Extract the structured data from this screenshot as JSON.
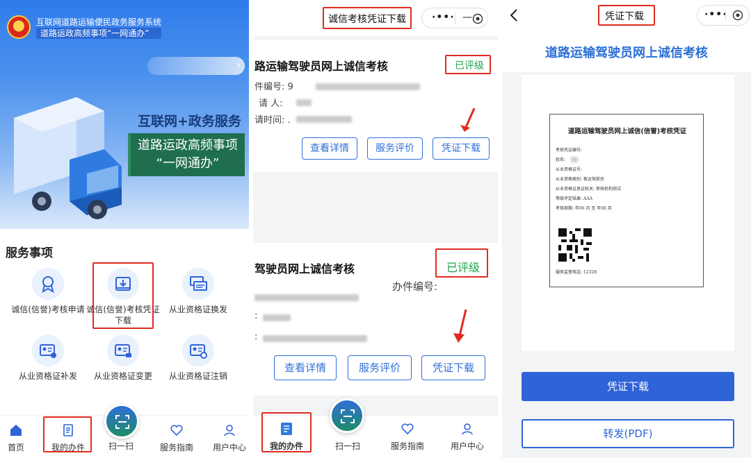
{
  "panel1": {
    "system_name": "互联网道路运输便民政务服务系统",
    "system_subtitle": "道路运政高频事项“一网通办”",
    "slogan_line": "互联网+政务服务",
    "banner_line1": "道路运政高频事项",
    "banner_line2": "“一网通办”",
    "services_title": "服务事项",
    "services": [
      {
        "label": "诚信(信誉)考核申请",
        "icon": "certificate-medal-icon"
      },
      {
        "label": "诚信(信誉)考核凭证下载",
        "icon": "download-tray-icon"
      },
      {
        "label": "从业资格证换发",
        "icon": "card-swap-icon"
      },
      {
        "label": "从业资格证补发",
        "icon": "id-card-add-icon"
      },
      {
        "label": "从业资格证变更",
        "icon": "id-card-edit-icon"
      },
      {
        "label": "从业资格证注销",
        "icon": "id-card-cancel-icon"
      }
    ],
    "tabs": [
      {
        "label": "首页",
        "icon": "home-icon"
      },
      {
        "label": "我的办件",
        "icon": "document-icon"
      },
      {
        "label": "扫一扫",
        "icon": "scan-icon"
      },
      {
        "label": "服务指南",
        "icon": "heart-icon"
      },
      {
        "label": "用户中心",
        "icon": "user-icon"
      }
    ]
  },
  "panel2": {
    "nav_title": "诚信考核凭证下载",
    "card1": {
      "title": "路运输驾驶员网上诚信考核",
      "status": "已评级",
      "field1_label": "件编号: 9",
      "field2_label": "请 人:",
      "field3_label": "请时间: .",
      "buttons": [
        "查看详情",
        "服务评价",
        "凭证下载"
      ]
    },
    "card2": {
      "title": "驾驶员网上诚信考核",
      "status": "已评级",
      "case_no_label": "办件编号:",
      "field_a": ":",
      "field_b": ": ",
      "buttons": [
        "查看详情",
        "服务评价",
        "凭证下载"
      ]
    },
    "tabs": [
      {
        "label": "我的办件",
        "icon": "list-icon"
      },
      {
        "label": "扫一扫",
        "icon": "scan-icon"
      },
      {
        "label": "服务指南",
        "icon": "heart-icon"
      },
      {
        "label": "用户中心",
        "icon": "user-icon"
      }
    ]
  },
  "panel3": {
    "nav_title": "凭证下载",
    "page_title": "道路运输驾驶员网上诚信考核",
    "certificate": {
      "heading": "道路运输驾驶员网上诚信(信誉)考核凭证",
      "lines": [
        "考核凭证编号:",
        "姓名:",
        "从业资格证号:",
        "从业资格类别: 客运驾驶员",
        "从业资格证发证机关: 审核机构测试",
        "等级评定结果: AAA",
        "考核周期:        年06  月 至         年06  月"
      ],
      "hotline": "服务监督电话: 12328"
    },
    "download_button": "凭证下载",
    "forward_button": "转发(PDF)"
  },
  "colors": {
    "accent_blue": "#2f63d8",
    "status_green": "#1ea34a",
    "highlight_red": "#e02b20"
  }
}
